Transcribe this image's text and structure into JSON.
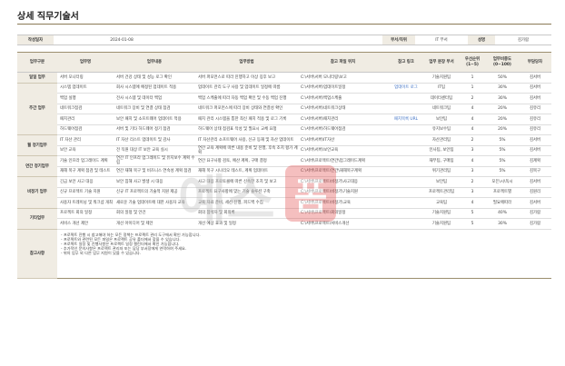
{
  "title": "상세 직무기술서",
  "info": {
    "author_label": "작성일자",
    "author_value": "2024-01-08",
    "dept_label": "부서/직위",
    "dept_value": "IT 부서",
    "pos_label": "성명",
    "pos_value": "김가람"
  },
  "headers": [
    "업무구분",
    "업무명",
    "업무내용",
    "업무방법",
    "참고 파일 위치",
    "참고 링크",
    "업무 분장 부서",
    "우선순위 (1~5)",
    "업무비중도 (0~100)",
    "부담당자"
  ],
  "groups": [
    {
      "category": "일일 업무",
      "rows": [
        [
          "서버 모니터링",
          "서버 건강 상태 및 성능 로그 확인",
          "서버 퍼포먼스로 따라 진행하고 이상 징후 보고",
          "C:\\서버\\서버 모니터링\\보고",
          "",
          "기술지원팀",
          "1",
          "50%",
          "김서버"
        ]
      ]
    },
    {
      "category": "주간 업무",
      "rows": [
        [
          "시스템 업데이트",
          "회사 시스템에 예정된 업데이트 적용",
          "업데이트 관리 도구 사용 및 업데이트 일정에 따름",
          "C:\\서버\\서버\\업데이트일정",
          "업데이트 로그",
          "IT팀",
          "1",
          "30%",
          "김서버"
        ],
        [
          "백업 실행",
          "전사 시스템 및 데이터 백업",
          "백업 스케줄에 따라 자동 백업 확인 및 수동 백업 진행",
          "C:\\서버\\서버\\백업스케줄",
          "",
          "데이터센터팀",
          "2",
          "30%",
          "김서버"
        ],
        [
          "네트워크점검",
          "네트워크 장비 및 연결 상태 점검",
          "네트워크 퍼포먼스에 따라 장비 상태와 연결성 확인",
          "C:\\서버\\서버\\네트워크상태",
          "",
          "네트워크팀",
          "4",
          "20%",
          "김유리"
        ],
        [
          "패치관리",
          "보안 패치 및 소프트웨어 업데이트 적용",
          "패치 관리 시스템을 통한 최신 패치 적용 및 로그 기록",
          "C:\\서버\\서버\\패치관리",
          "패치목록 URL",
          "보안팀",
          "4",
          "20%",
          "김유리"
        ],
        [
          "하드웨어점검",
          "서버 및 기타 하드웨어 정기 점검",
          "하드웨어 상태 점검표 작성 및 필요시 교체 요청",
          "C:\\서버\\서버\\하드웨어점검",
          "",
          "유지보수팀",
          "4",
          "20%",
          "김유리"
        ]
      ]
    },
    {
      "category": "월 정기업무",
      "rows": [
        [
          "IT 자산 관리",
          "IT 자산 리스트 업데이트 및 감사",
          "IT 자산관리 소프트웨어 사용, 신규 등재 및 자산 업데이트",
          "C:\\서버\\서버\\IT자산",
          "",
          "자산관리팀",
          "2",
          "5%",
          "김서버"
        ],
        [
          "보안 교육",
          "전 직원 대상 IT 보안 교육 실시",
          "연간 교육 계획에 따른 내용 준비 및 진행, 후속 조치 평가 계획",
          "C:\\서버\\서버\\보안교육",
          "",
          "인사팀, 보안팀",
          "3",
          "5%",
          "김서버"
        ]
      ]
    },
    {
      "category": "연간 정기업무",
      "rows": [
        [
          "기술 인프라 업그레이드 계획",
          "연간 IT 인프라 업그레이드 및 유지보수 계획 수립",
          "연간 요구사항 검토, 예산 계획, 구매 결정",
          "C:\\서버\\프로젝트\\연간\\업그레이드계획",
          "",
          "재무팀, 구매팀",
          "4",
          "5%",
          "김계획"
        ],
        [
          "재해 복구 계획 점검 및 테스트",
          "연간 재해 복구 및 비즈니스 연속성 계획 점검",
          "재해 복구 시나리오 테스트, 계획 업데이트",
          "C:\\서버\\프로젝트\\연간\\재해복구계획",
          "",
          "위기관리팀",
          "3",
          "5%",
          "김복구"
        ]
      ]
    },
    {
      "category": "비정기 업무",
      "rows": [
        [
          "긴급 보안 사고 대응",
          "보안 침해 사고 발생 시 대응",
          "사고 대응 프로토콜에 따른 신속한 조치 및 보고",
          "C:\\서버\\프로젝트\\비정기\\사고대응",
          "",
          "보안팀",
          "2",
          "모든\\시\\독시",
          "김서버"
        ],
        [
          "신규 프로젝트 기술 지원",
          "신규 IT 프로젝트의 기술적 지원 제공",
          "프로젝트 요구사항에 맞는 기술 솔루션 구축",
          "C:\\서버\\프로젝트\\비정기\\기술지원",
          "",
          "프로젝트관리팀",
          "3",
          "프로젝트별",
          "김원리"
        ],
        [
          "사용자 트레이닝 및 워크샵 개최",
          "새로운 기술 업데이트에 대한 사용자 교육",
          "교육 자료 준비, 세션 진행, 피드백 수집",
          "C:\\서버\\프로젝트\\비정기\\교육",
          "",
          "교육팀",
          "4",
          "필요에따라",
          "김서버"
        ]
      ]
    },
    {
      "category": "기타업무",
      "rows": [
        [
          "프로젝트 회의 일정",
          "회의 일정 및 안건",
          "회의 참석자 및 회의록",
          "C:\\서버\\프로젝트\\회의일정",
          "",
          "기술지원팀",
          "5",
          "40%",
          "김가람"
        ],
        [
          "서비스 개선 제안",
          "개선 아이디어 및 제안",
          "개선 예상 효과 및 일정",
          "C:\\서버\\프로젝트\\서비스개선",
          "",
          "기술지원팀",
          "5",
          "30%",
          "김가람"
        ]
      ]
    }
  ],
  "notes_label": "참고사항",
  "notes": [
    "- 프로젝트 진행 시 참고해야 하는 모든 정책는 프로젝트 관리 도구에서 확인 가능합니다.",
    "- 프로젝트와 관련된 모든 파일은 프로젝트 공유 폴더에서 찾을 수 있습니다.",
    "- 프로젝트 일정 및 진행사항은 프로젝트 일정 캘린더에서 확인 가능합니다.",
    "- 추가적인 문의사항은 프로젝트 관리자 또는 담당 부서장에게 연락하여 주세요.",
    "- 위의 업무 외 다른 업무 지원이 있을 수 있습니다."
  ],
  "watermark": {
    "text": "예스폼",
    "color": "#e54b4b"
  }
}
